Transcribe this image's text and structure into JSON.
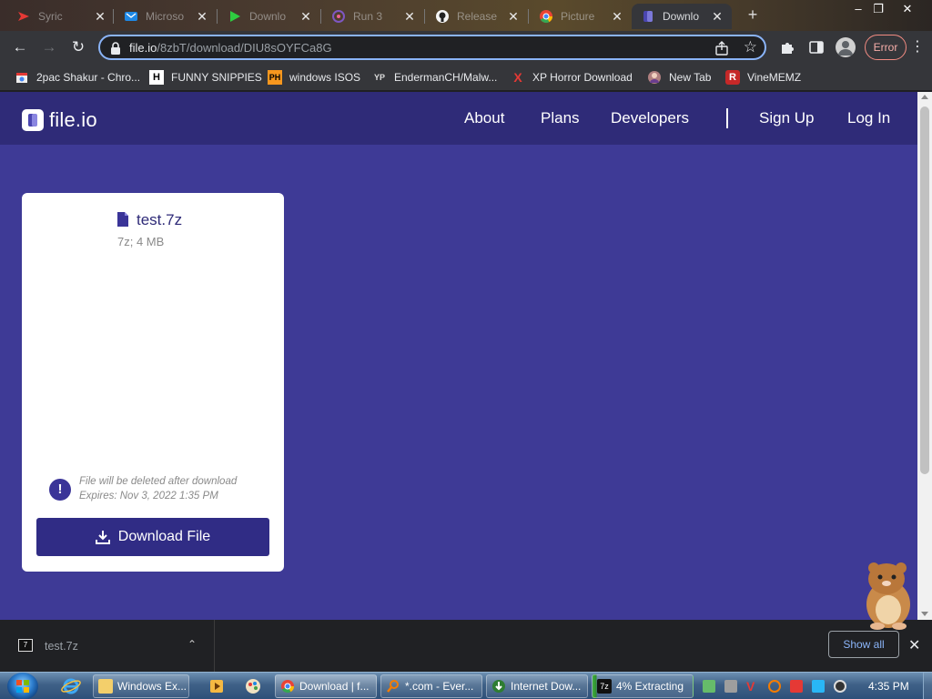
{
  "browser": {
    "tabs": [
      {
        "title": "Syric",
        "icon": "youtube-icon",
        "active": false
      },
      {
        "title": "Microso",
        "icon": "outlook-icon",
        "active": false
      },
      {
        "title": "Downlo",
        "icon": "play-icon",
        "active": false
      },
      {
        "title": "Run 3",
        "icon": "game-icon",
        "active": false
      },
      {
        "title": "Release",
        "icon": "github-icon",
        "active": false
      },
      {
        "title": "Picture",
        "icon": "chrome-icon",
        "active": false
      },
      {
        "title": "Downlo",
        "icon": "fileio-icon",
        "active": true
      }
    ],
    "address": {
      "host": "file.io",
      "path": "/8zbT/download/DIU8sOYFCa8G"
    },
    "error_label": "Error",
    "bookmarks": [
      {
        "label": "2pac Shakur - Chro...",
        "icon": "chrome-store-icon"
      },
      {
        "label": "FUNNY SNIPPIES",
        "icon": "h-icon"
      },
      {
        "label": "windows ISOS",
        "icon": "ph-icon"
      },
      {
        "label": "EndermanCH/Malw...",
        "icon": "yp-icon"
      },
      {
        "label": "XP Horror Download",
        "icon": "x-icon"
      },
      {
        "label": "New Tab",
        "icon": "avatar-icon"
      },
      {
        "label": "VineMEMZ",
        "icon": "r-icon"
      }
    ]
  },
  "site": {
    "logo_text": "file.io",
    "nav": {
      "about": "About",
      "plans": "Plans",
      "developers": "Developers",
      "sign_up": "Sign Up",
      "log_in": "Log In"
    },
    "file": {
      "name": "test.7z",
      "meta": "7z; 4 MB",
      "warning_line1": "File will be deleted after download",
      "warning_line2": "Expires: Nov 3, 2022 1:35 PM",
      "download_label": "Download File"
    },
    "colors": {
      "page_bg": "#3e3a96",
      "header_bg": "#2f2b78",
      "button_bg": "#302c85"
    }
  },
  "download_shelf": {
    "item_name": "test.7z",
    "show_all_label": "Show all"
  },
  "taskbar": {
    "buttons": [
      {
        "label": "Windows Ex...",
        "icon": "folder-icon"
      },
      {
        "label": "Download | f...",
        "icon": "chrome-icon",
        "active": true
      },
      {
        "label": "*.com - Ever...",
        "icon": "search-everything-icon"
      },
      {
        "label": "Internet Dow...",
        "icon": "idm-icon"
      },
      {
        "label": "4% Extracting",
        "icon": "7zip-icon",
        "progress_percent": 4
      }
    ],
    "clock": "4:35 PM"
  }
}
